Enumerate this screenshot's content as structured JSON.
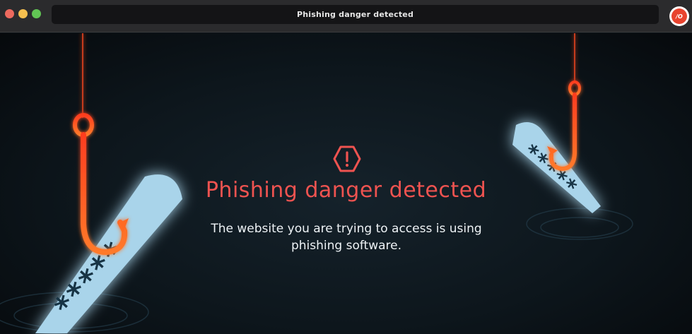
{
  "window": {
    "title": "Phishing danger detected",
    "extension_badge_text": "/O"
  },
  "alert": {
    "icon": "warning-octagon-icon",
    "heading": "Phishing danger detected",
    "message": "The website you are trying to access is using phishing software."
  },
  "colors": {
    "accent_red": "#ef5350",
    "hook_orange": "#ff5a1f",
    "card_blue": "#a9d4ea",
    "background": "#0e1419"
  },
  "illustrations": {
    "left_card_text": "*****",
    "right_card_text": "*****"
  }
}
